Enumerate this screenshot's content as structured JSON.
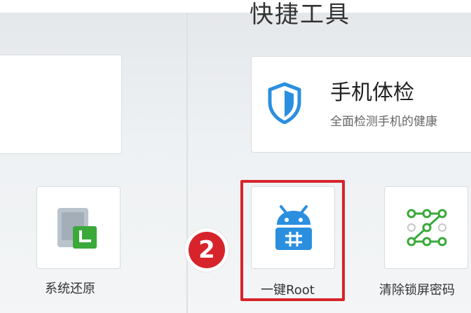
{
  "header": {
    "title": "快捷工具"
  },
  "phone_check": {
    "title": "手机体检",
    "description": "全面检测手机的健康",
    "icon": "shield-icon"
  },
  "tools": [
    {
      "label": "系统还原",
      "icon": "system-restore-icon"
    },
    {
      "label": "一键Root",
      "icon": "android-root-icon"
    },
    {
      "label": "清除锁屏密码",
      "icon": "pattern-lock-icon"
    }
  ],
  "annotation": {
    "step": "2",
    "highlight_color": "#d7232b"
  },
  "colors": {
    "accent_blue": "#2b8fe0",
    "green": "#3aa93a"
  }
}
